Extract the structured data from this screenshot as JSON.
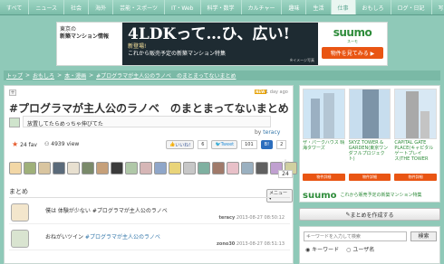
{
  "nav": [
    "すべて",
    "ニュース",
    "社会",
    "海外",
    "芸能・スポーツ",
    "IT・Web",
    "科学・数学",
    "カルチャー",
    "趣味",
    "生活",
    "仕事",
    "おもしろ",
    "ログ・日記",
    "写真"
  ],
  "nav_active": 10,
  "banner": {
    "tokyo_line1": "東京の",
    "tokyo_line2": "新築マンション情報",
    "headline": "4LDKって…ひ、広い!",
    "sub1": "新登場!",
    "sub2": "これから販売予定の新築マンション特集",
    "img_note": "※イメージ写真",
    "brand": "suumo",
    "brand_sub": "スーモ",
    "cta": "物件を見てみる ▶"
  },
  "breadcrumb": [
    "トップ",
    "おもしろ",
    "本・漫画",
    "#プログラマが主人公のラノベ　のまとまってないまとめ"
  ],
  "post": {
    "new_badge": "NEW",
    "time_ago": "1 day ago",
    "title": "#プログラマが主人公のラノベ　のまとまってないまとめ",
    "description": "放置してたらめっちゃ伸びてた",
    "by_label": "by",
    "author": "teracy",
    "fav_count": "24 fav",
    "view_count": "4939 view",
    "like_label": "いいね!",
    "like_count": "6",
    "tweet_label": "Tweet",
    "tweet_count": "101",
    "hatena_count": "2",
    "fav_total": "24"
  },
  "summary": {
    "heading": "まとめ",
    "menu_label": "メニュー",
    "entries": [
      {
        "text": "僕は 体験が少ない #プログラマが主人公のラノベ",
        "link": "",
        "author": "teracy",
        "time": "2013-08-27 08:50:12"
      },
      {
        "text": "おねがいツイン ",
        "link": "#プログラマが主人公のラノベ",
        "author": "zono30",
        "time": "2013-08-27 08:51:13"
      }
    ]
  },
  "sidebar": {
    "buildings": [
      {
        "label": "ザ・パークハウス 晴海タワーズ",
        "btn": "物件詳細"
      },
      {
        "label": "SKYZ TOWER & GARDEN(東京ワンダフルプロジェクト)",
        "btn": "物件詳細"
      },
      {
        "label": "CAPITAL GATE PLACE(キャピタルゲートプレイス)THE TOWER",
        "btn": "物件詳細"
      }
    ],
    "ad_brand": "suumo",
    "ad_text": "これから販売予定の新築マンション特集",
    "create_label": "まとめを作成する",
    "search_placeholder": "キーワードを入力して検索",
    "search_button": "検索",
    "radio_keyword": "キーワード",
    "radio_user": "ユーザ名"
  },
  "colors": {
    "accent": "#8fc9b8",
    "brand_green": "#2e8c3a",
    "cta_orange": "#e95513"
  }
}
